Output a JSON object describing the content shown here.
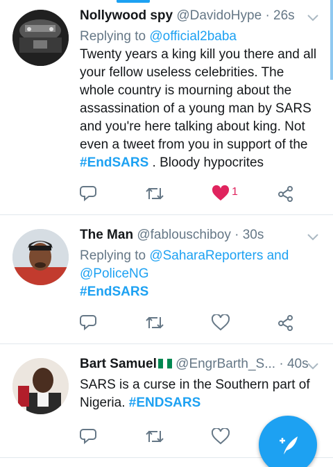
{
  "colors": {
    "accent": "#1da1f2",
    "like": "#e0245e",
    "muted": "#657786",
    "text": "#14171a"
  },
  "tweets": [
    {
      "name": "Nollywood spy",
      "handle": "@DavidoHype",
      "time": "· 26s",
      "reply_prefix": "Replying to",
      "reply_to": "@official2baba",
      "text": "Twenty years a king kill you there and all your fellow useless celebrities. The whole country is mourning about the assassination of a young man by SARS and you're here talking about king. Not even a tweet from you in support of the",
      "hashtag": "#EndSARS",
      "text_after": ". Bloody hypocrites",
      "likes": "1",
      "liked": true
    },
    {
      "name": "The Man",
      "handle": "@fablouschiboy",
      "time": "· 30s",
      "reply_prefix": "Replying to",
      "reply_to": "@SaharaReporters and @PoliceNG",
      "hashtag": "#EndSARS",
      "liked": false
    },
    {
      "name": "Bart Samuel",
      "handle": "@EngrBarth_S...",
      "time": "· 40s",
      "text": "SARS is a curse in the Southern part of Nigeria.",
      "hashtag": "#ENDSARS",
      "liked": false
    }
  ],
  "icons": {
    "reply": "reply-icon",
    "retweet": "retweet-icon",
    "like": "heart-icon",
    "share": "share-icon",
    "menu": "chevron-down-icon",
    "compose": "compose-tweet-icon"
  }
}
